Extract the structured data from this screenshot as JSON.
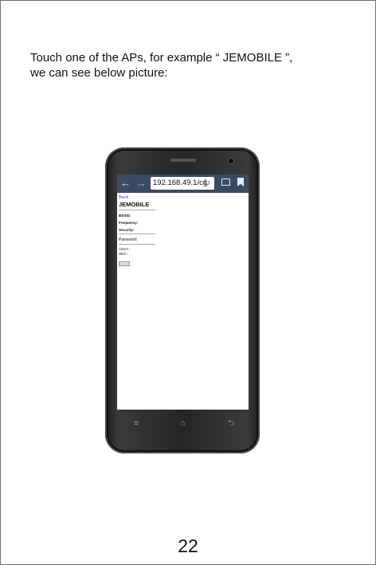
{
  "intro": {
    "line1": "Touch one of the APs, for example “ JEMOBILE ”,",
    "line2": "we can see below picture:"
  },
  "phone": {
    "browser": {
      "back_arrow": "←",
      "forward_arrow": "→",
      "url": "192.168.49.1/cg",
      "reload_glyph": "↻"
    },
    "page": {
      "back_link": "Back",
      "ssid": "JEMOBILE",
      "bssid_label": "BSSID:",
      "bssid_value": "",
      "frequency_label": "Frequency:",
      "frequency_value": "",
      "security_label": "Security:",
      "security_value": "",
      "password_label": "Password:",
      "ascii_option": "ASCII ◦",
      "hex_option": "HEX ◦",
      "submit_label": ""
    },
    "soft_keys": {
      "menu": "≡",
      "home": "⌂",
      "back": "⮌"
    }
  },
  "page_number": "22"
}
